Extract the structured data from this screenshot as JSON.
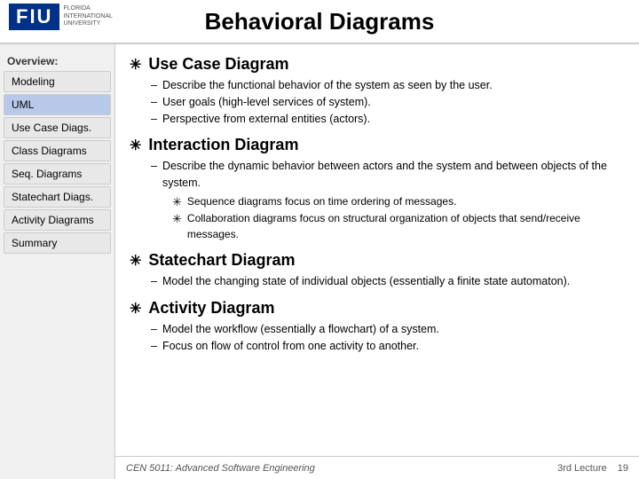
{
  "header": {
    "title": "Behavioral Diagrams",
    "logo_text": "FIU",
    "logo_sub": "FLORIDA INTERNATIONAL UNIVERSITY"
  },
  "sidebar": {
    "overview_label": "Overview:",
    "items": [
      {
        "id": "modeling",
        "label": "Modeling",
        "active": false
      },
      {
        "id": "uml",
        "label": "UML",
        "active": false,
        "highlight": true
      },
      {
        "id": "use-case-diags",
        "label": "Use Case Diags.",
        "active": false
      },
      {
        "id": "class-diagrams",
        "label": "Class Diagrams",
        "active": false
      },
      {
        "id": "seq-diagrams",
        "label": "Seq. Diagrams",
        "active": false
      },
      {
        "id": "statechart-diags",
        "label": "Statechart Diags.",
        "active": false
      },
      {
        "id": "activity-diagrams",
        "label": "Activity Diagrams",
        "active": false
      },
      {
        "id": "summary",
        "label": "Summary",
        "active": false
      }
    ]
  },
  "content": {
    "sections": [
      {
        "id": "use-case",
        "title": "Use Case Diagram",
        "bullet": "✳",
        "items": [
          "Describe the functional behavior of the system as seen by the user.",
          "User goals (high-level services of system).",
          "Perspective from external entities (actors)."
        ]
      },
      {
        "id": "interaction",
        "title": "Interaction Diagram",
        "bullet": "✳",
        "items": [
          "Describe the dynamic behavior between actors and the system and between objects of the system."
        ],
        "subitems": [
          "Sequence diagrams focus on time ordering of messages.",
          "Collaboration diagrams focus on structural organization of objects that send/receive messages."
        ]
      },
      {
        "id": "statechart",
        "title": "Statechart Diagram",
        "bullet": "✳",
        "items": [
          "Model the changing state of individual objects (essentially a finite state automaton)."
        ]
      },
      {
        "id": "activity",
        "title": "Activity Diagram",
        "bullet": "✳",
        "items": [
          "Model the workflow (essentially a flowchart) of a system.",
          "Focus on flow of control from one activity to another."
        ]
      }
    ]
  },
  "footer": {
    "course": "CEN 5011: Advanced Software Engineering",
    "lecture": "3rd Lecture",
    "page": "19"
  }
}
